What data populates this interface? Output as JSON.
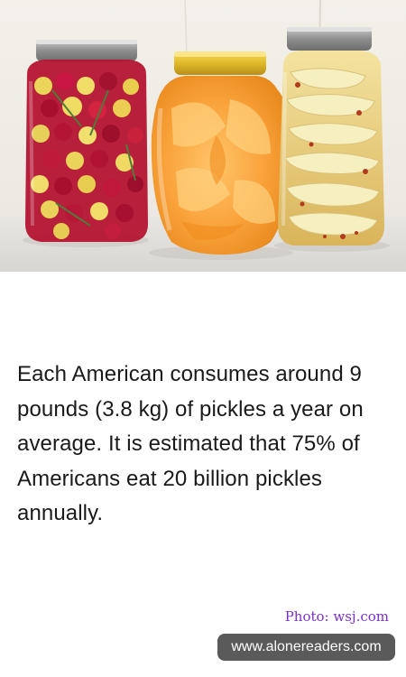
{
  "photo": {
    "subject": "pickle-jars"
  },
  "fact": {
    "text": "Each American consumes around 9 pounds (3.8 kg) of pickles a year on average. It is estimated that 75% of Americans eat 20 billion pickles annually."
  },
  "credit": {
    "text": "Photo: wsj.com"
  },
  "site": {
    "url": "www.alonereaders.com"
  },
  "colors": {
    "credit": "#7a2fd1",
    "badge": "#5a5a5a",
    "text": "#1a1a1a"
  }
}
